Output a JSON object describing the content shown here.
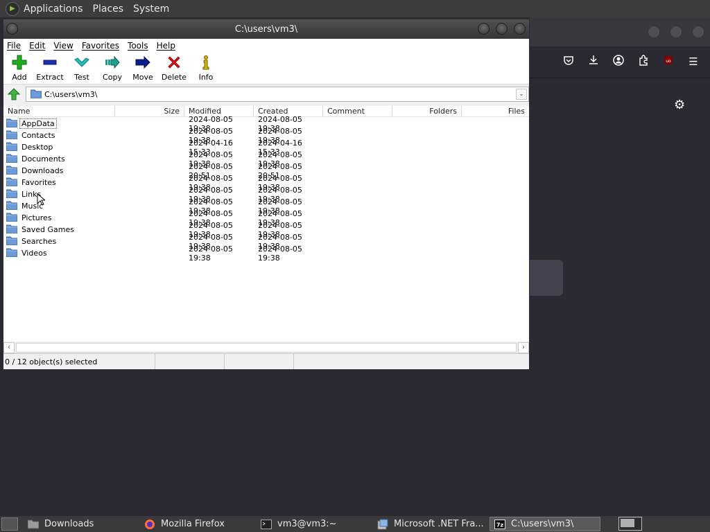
{
  "top_panel": {
    "menus": [
      "Applications",
      "Places",
      "System"
    ]
  },
  "window": {
    "title": "C:\\users\\vm3\\",
    "menu": [
      "File",
      "Edit",
      "View",
      "Favorites",
      "Tools",
      "Help"
    ],
    "toolbar": [
      {
        "label": "Add",
        "icon": "plus-icon",
        "color": "#22aa22"
      },
      {
        "label": "Extract",
        "icon": "minus-icon",
        "color": "#1a2fb0"
      },
      {
        "label": "Test",
        "icon": "checkmark-icon",
        "color": "#20b8b8"
      },
      {
        "label": "Copy",
        "icon": "copy-arrow-icon",
        "color": "#1f9f8a"
      },
      {
        "label": "Move",
        "icon": "move-arrow-icon",
        "color": "#0a1f8c"
      },
      {
        "label": "Delete",
        "icon": "delete-x-icon",
        "color": "#dd1111"
      },
      {
        "label": "Info",
        "icon": "info-icon",
        "color": "#d4b800"
      }
    ],
    "address": "C:\\users\\vm3\\",
    "columns": [
      "Name",
      "Size",
      "Modified",
      "Created",
      "Comment",
      "Folders",
      "Files"
    ],
    "rows": [
      {
        "name": "AppData",
        "modified": "2024-08-05 19:38",
        "created": "2024-08-05 19:38"
      },
      {
        "name": "Contacts",
        "modified": "2024-08-05 19:38",
        "created": "2024-08-05 19:38"
      },
      {
        "name": "Desktop",
        "modified": "2024-04-16 15:33",
        "created": "2024-04-16 15:33"
      },
      {
        "name": "Documents",
        "modified": "2024-08-05 19:38",
        "created": "2024-08-05 19:38"
      },
      {
        "name": "Downloads",
        "modified": "2024-08-05 20:51",
        "created": "2024-08-05 20:51"
      },
      {
        "name": "Favorites",
        "modified": "2024-08-05 19:38",
        "created": "2024-08-05 19:38"
      },
      {
        "name": "Links",
        "modified": "2024-08-05 19:38",
        "created": "2024-08-05 19:38"
      },
      {
        "name": "Music",
        "modified": "2024-08-05 19:38",
        "created": "2024-08-05 19:38"
      },
      {
        "name": "Pictures",
        "modified": "2024-08-05 19:38",
        "created": "2024-08-05 19:38"
      },
      {
        "name": "Saved Games",
        "modified": "2024-08-05 19:38",
        "created": "2024-08-05 19:38"
      },
      {
        "name": "Searches",
        "modified": "2024-08-05 19:38",
        "created": "2024-08-05 19:38"
      },
      {
        "name": "Videos",
        "modified": "2024-08-05 19:38",
        "created": "2024-08-05 19:38"
      }
    ],
    "status": "0 / 12 object(s) selected"
  },
  "taskbar": {
    "tasks": [
      {
        "label": "Downloads",
        "icon": "folder-icon"
      },
      {
        "label": "Mozilla Firefox",
        "icon": "firefox-icon"
      },
      {
        "label": "vm3@vm3:~",
        "icon": "terminal-icon"
      },
      {
        "label": "Microsoft .NET Fra...",
        "icon": "installer-icon"
      },
      {
        "label": "C:\\users\\vm3\\",
        "icon": "7zip-icon",
        "active": true
      }
    ]
  },
  "colors": {
    "desktop_bg": "#2b2a33",
    "folder": "#6d9bd8",
    "ublock": "#800000"
  }
}
